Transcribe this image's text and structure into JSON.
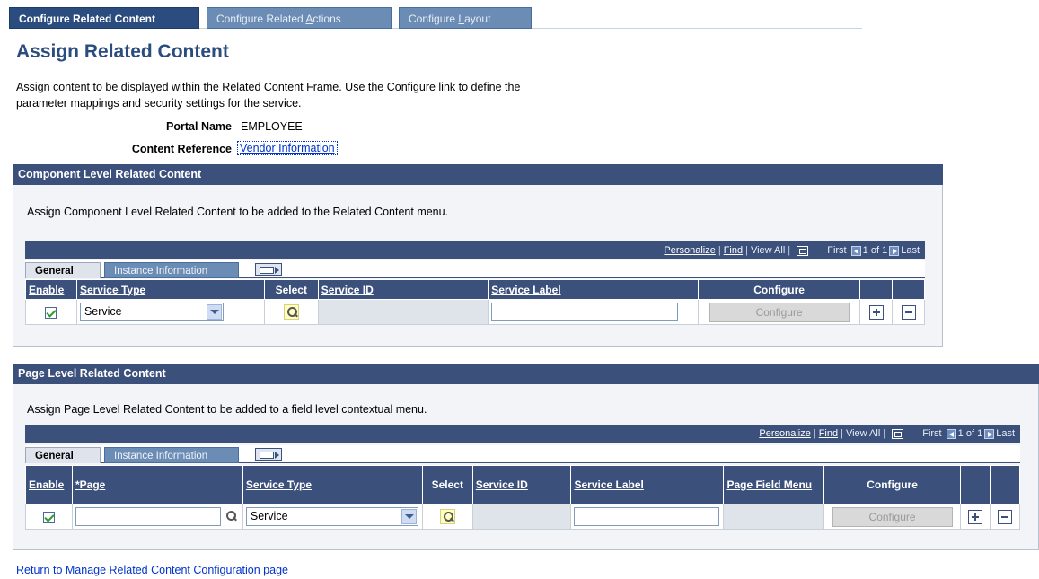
{
  "top_tabs": [
    {
      "label_pre": "Configure Related Content",
      "label_ul": "",
      "label_post": ""
    },
    {
      "label_pre": "Configure Related ",
      "label_ul": "A",
      "label_post": "ctions"
    },
    {
      "label_pre": "Configure ",
      "label_ul": "L",
      "label_post": "ayout"
    }
  ],
  "page_title": "Assign Related Content",
  "description": "Assign content to be displayed within the Related Content Frame. Use the Configure link to define the parameter mappings and security settings for the service.",
  "portal_name": {
    "label": "Portal Name",
    "value": "EMPLOYEE"
  },
  "content_reference": {
    "label": "Content Reference",
    "value": "Vendor Information"
  },
  "component_section": {
    "title": "Component Level Related Content",
    "description": "Assign Component Level Related Content to be added to the Related Content menu.",
    "nav": {
      "personalize": "Personalize",
      "find": "Find",
      "view_all": "View All",
      "first": "First",
      "range": "1 of 1",
      "last": "Last"
    },
    "tabs": [
      "General",
      "Instance Information"
    ],
    "columns": {
      "enable": "Enable",
      "service_type": "Service Type",
      "select": "Select",
      "service_id": "Service ID",
      "service_label": "Service Label",
      "configure": "Configure"
    },
    "row": {
      "enabled": true,
      "service_type": "Service",
      "service_id": "",
      "service_label": "",
      "configure_button": "Configure"
    }
  },
  "page_section": {
    "title": "Page Level Related Content",
    "description": "Assign Page Level Related Content to be added to a field level contextual menu.",
    "nav": {
      "personalize": "Personalize",
      "find": "Find",
      "view_all": "View All",
      "first": "First",
      "range": "1 of 1",
      "last": "Last"
    },
    "tabs": [
      "General",
      "Instance Information"
    ],
    "columns": {
      "enable": "Enable",
      "page": "*Page",
      "service_type": "Service Type",
      "select": "Select",
      "service_id": "Service ID",
      "service_label": "Service Label",
      "page_field_menu": "Page Field Menu",
      "configure": "Configure"
    },
    "row": {
      "enabled": true,
      "page": "",
      "service_type": "Service",
      "service_id": "",
      "service_label": "",
      "page_field_menu": "",
      "configure_button": "Configure"
    }
  },
  "return_link": "Return to Manage Related Content Configuration page"
}
